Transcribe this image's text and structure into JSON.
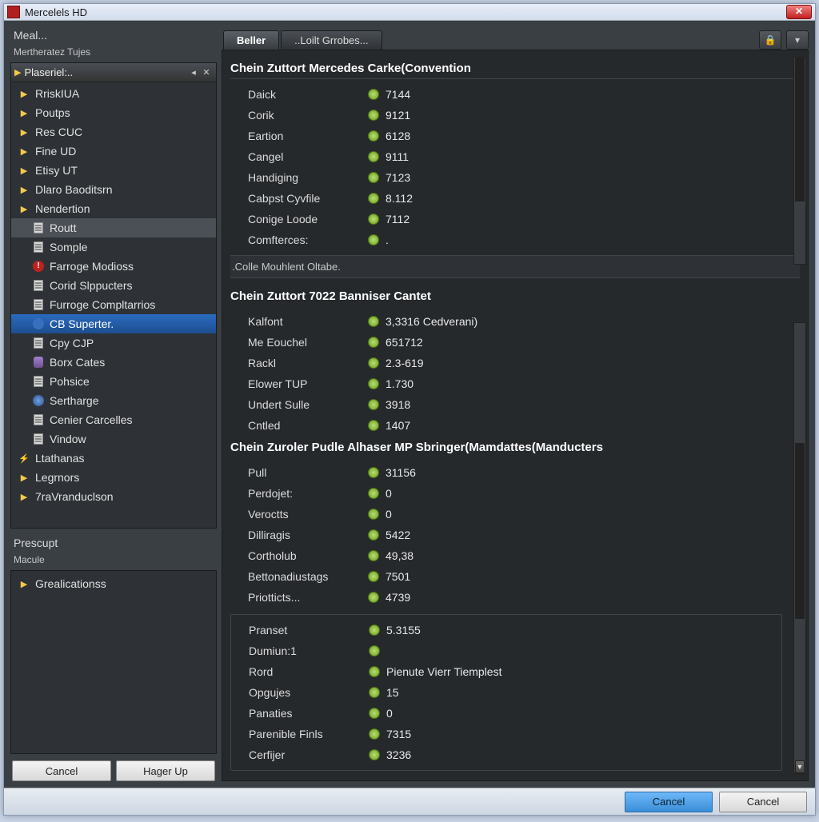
{
  "window": {
    "title": "Mercelels HD"
  },
  "left": {
    "menu_label": "Meal...",
    "subheader": "Mertheratez Tujes",
    "tree_header": "Plaseriel:..",
    "items": [
      {
        "label": "RriskIUA",
        "type": "arrow"
      },
      {
        "label": "Poutps",
        "type": "arrow"
      },
      {
        "label": "Res CUC",
        "type": "arrow"
      },
      {
        "label": "Fine UD",
        "type": "arrow"
      },
      {
        "label": "Etisy UT",
        "type": "arrow"
      },
      {
        "label": "Dlaro Baoditsrn",
        "type": "arrow"
      },
      {
        "label": "Nendertion",
        "type": "arrow"
      },
      {
        "label": "Routt",
        "type": "doc",
        "child": true,
        "sel2": true
      },
      {
        "label": "Somple",
        "type": "doc",
        "child": true
      },
      {
        "label": "Farroge Modioss",
        "type": "red",
        "child": true
      },
      {
        "label": "Corid Slppucters",
        "type": "doc",
        "child": true
      },
      {
        "label": "Furroge Compltarrios",
        "type": "doc",
        "child": true
      },
      {
        "label": "CB Superter.",
        "type": "blue",
        "child": true,
        "sel": true
      },
      {
        "label": "Cpy CJP",
        "type": "doc",
        "child": true
      },
      {
        "label": "Borx Cates",
        "type": "cyl",
        "child": true
      },
      {
        "label": "Pohsice",
        "type": "doc",
        "child": true
      },
      {
        "label": "Sertharge",
        "type": "globe",
        "child": true
      },
      {
        "label": "Cenier Carcelles",
        "type": "doc",
        "child": true
      },
      {
        "label": "Vindow",
        "type": "doc",
        "child": true
      },
      {
        "label": "Ltathanas",
        "type": "flash"
      },
      {
        "label": "Legrnors",
        "type": "arrow"
      },
      {
        "label": "7raVranduclson",
        "type": "arrow"
      }
    ],
    "prescupt_label": "Prescupt",
    "macule_label": "Macule",
    "prescupt_items": [
      {
        "label": "Grealicationss",
        "type": "arrow"
      }
    ],
    "btn_cancel": "Cancel",
    "btn_hager": "Hager Up"
  },
  "tabs": {
    "active": "Beller",
    "secondary": "..Loilt Grrobes..."
  },
  "content": {
    "section1": {
      "title": "Chein Zuttort Mercedes Carke(Convention",
      "props": [
        {
          "name": "Daick",
          "value": "7144"
        },
        {
          "name": "Corik",
          "value": "9121"
        },
        {
          "name": "Eartion",
          "value": "6128"
        },
        {
          "name": "Cangel",
          "value": "9111"
        },
        {
          "name": "Handiging",
          "value": "7123"
        },
        {
          "name": "Cabpst Cyvfile",
          "value": "8.112"
        },
        {
          "name": "Conige Loode",
          "value": "7112"
        },
        {
          "name": "Comfterces:",
          "value": "."
        }
      ]
    },
    "subdivider": ".Colle Mouhlent Oltabe.",
    "section2": {
      "title": "Chein Zuttort 7022 Banniser Cantet",
      "props": [
        {
          "name": "Kalfont",
          "value": "3,3316 Cedverani)"
        },
        {
          "name": "Me Eouchel",
          "value": "651712"
        },
        {
          "name": "Rackl",
          "value": "2.3-619"
        },
        {
          "name": "Elower TUP",
          "value": "1.730"
        },
        {
          "name": "Undert Sulle",
          "value": "3918"
        },
        {
          "name": "Cntled",
          "value": "1407"
        }
      ]
    },
    "section3": {
      "title": "Chein Zuroler Pudle Alhaser MP Sbringer(Mamdattes(Manducters",
      "props": [
        {
          "name": "Pull",
          "value": "31156"
        },
        {
          "name": "Perdojet:",
          "value": "0"
        },
        {
          "name": "Veroctts",
          "value": "0"
        },
        {
          "name": "Dilliragis",
          "value": "5422"
        },
        {
          "name": "Cortholub",
          "value": "49,38"
        },
        {
          "name": "Bettonadiustags",
          "value": "7501"
        },
        {
          "name": "Priotticts...",
          "value": "4739"
        }
      ]
    },
    "section4": {
      "props": [
        {
          "name": "Pranset",
          "value": "5.3155"
        },
        {
          "name": "Dumiun:1",
          "value": ""
        },
        {
          "name": "Rord",
          "value": "Pienute Vierr Tiemplest"
        },
        {
          "name": "Opgujes",
          "value": "15"
        },
        {
          "name": "Panaties",
          "value": "0"
        },
        {
          "name": "Parenible Finls",
          "value": "7315"
        },
        {
          "name": "Cerfijer",
          "value": "3236"
        }
      ]
    }
  },
  "dialog": {
    "btn1": "Cancel",
    "btn2": "Cancel"
  }
}
